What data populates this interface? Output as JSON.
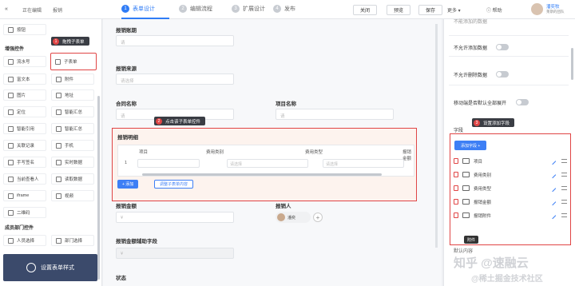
{
  "topbar": {
    "back_label": "«",
    "editing_label": "正在编辑",
    "form_name": "报销",
    "steps": [
      {
        "num": "1",
        "label": "表单设计"
      },
      {
        "num": "2",
        "label": "编辑流程"
      },
      {
        "num": "3",
        "label": "扩展设计"
      },
      {
        "num": "4",
        "label": "发布"
      }
    ],
    "close_label": "关闭",
    "preview_label": "预览",
    "save_label": "保存",
    "more_label": "更多 ▾",
    "help_label": "帮助",
    "user_name": "潘奕牧",
    "user_team": "莱斯的团队"
  },
  "left": {
    "top_items": [
      "按钮",
      "子表单"
    ],
    "enhanced_title": "增强控件",
    "items": [
      [
        "流水号",
        "子表单"
      ],
      [
        "富文本",
        "附件"
      ],
      [
        "图片",
        "地址"
      ],
      [
        "定位",
        "智能汇总"
      ],
      [
        "智能引用",
        "智能汇总"
      ],
      [
        "关联记录",
        "手机"
      ],
      [
        "手写签名",
        "实时数据"
      ],
      [
        "当前查看人",
        "读取数据"
      ],
      [
        "iframe",
        "视频"
      ],
      [
        "二维码",
        ""
      ]
    ],
    "member_title": "成员部门控件",
    "member_items": [
      "人员选择",
      "部门选择"
    ],
    "settings_label": "设置表单样式"
  },
  "canvas": {
    "f1_label": "报销账期",
    "f1_placeholder": "请",
    "f2_label": "报销来源",
    "f2_placeholder": "请选择",
    "f3_label": "合同名称",
    "f3_placeholder": "请",
    "f4_label": "项目名称",
    "f4_placeholder": "请",
    "sub_title": "报销明细",
    "sub_headers": [
      "项目",
      "费用类别",
      "费用类型",
      "报销金额"
    ],
    "row_num": "1",
    "select_placeholder": "请选择",
    "add_btn": "+ 添加",
    "batch_btn": "调整子表单内容",
    "total_label": "报销金额",
    "total_placeholder": "¥",
    "reporter_label": "报销人",
    "reporter_name": "潘奕",
    "total_aux_label": "报销金额辅助字段",
    "total_aux_placeholder": "¥",
    "status_label": "状态"
  },
  "right": {
    "top_cut": "不能添加的数据",
    "opt1": "不允许添加数据",
    "opt2": "不允许删除数据",
    "opt3": "移动端是否默认全部展开",
    "fields_title": "字段",
    "add_field_btn": "添加字段 +",
    "fields": [
      "项目",
      "费用类别",
      "费用类型",
      "报销金额",
      "报销附件"
    ],
    "tooltip": "附件",
    "default_label": "默认内容"
  },
  "callouts": [
    {
      "num": "1",
      "text": "拖拽子表单"
    },
    {
      "num": "2",
      "text": "点击该子表单控件"
    },
    {
      "num": "3",
      "text": "设置添加字段"
    }
  ],
  "watermark": "知乎 @速融云",
  "watermark2": "@稀土掘金技术社区"
}
